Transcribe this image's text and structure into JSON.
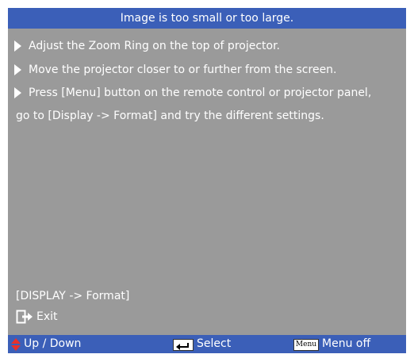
{
  "header": {
    "title": "Image is too small or too large."
  },
  "content": {
    "items": [
      {
        "text": "Adjust the Zoom Ring on the top of projector."
      },
      {
        "text": "Move the projector closer to or further from the screen."
      },
      {
        "text": "Press [Menu] button on the remote control or projector panel,"
      },
      {
        "text": "go to [Display -> Format] and try the different settings."
      }
    ],
    "path": "[DISPLAY -> Format]",
    "exit_label": "Exit"
  },
  "footer": {
    "updown_label": "Up / Down",
    "select_label": "Select",
    "menu_key_label": "Menu",
    "menu_off_label": "Menu off"
  },
  "colors": {
    "title_bar": "#3b5fb8",
    "panel": "#9a9a9a",
    "updown_icon": "#e8302a"
  },
  "icons": {
    "bullet": "play-triangle-icon",
    "exit": "exit-door-arrow-icon",
    "updown": "up-down-arrows-icon",
    "enter": "enter-key-icon"
  }
}
